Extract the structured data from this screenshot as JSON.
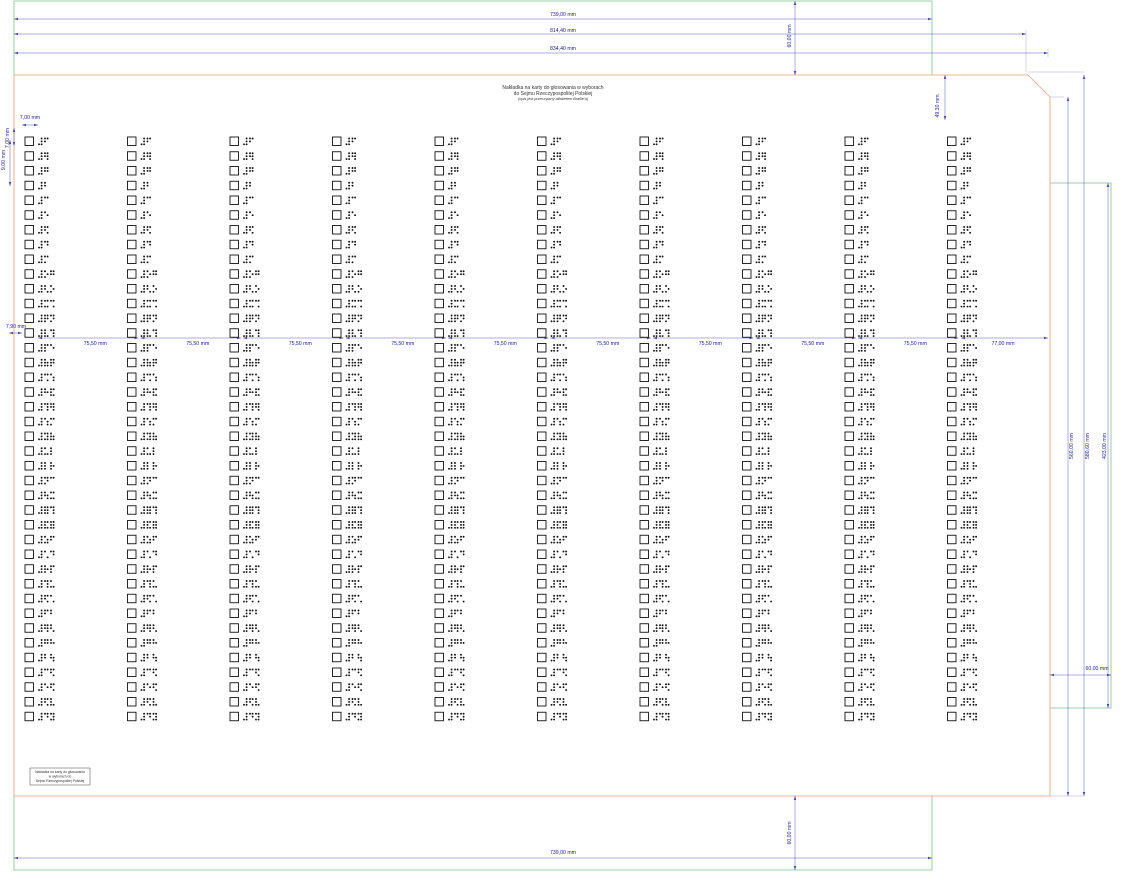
{
  "title": {
    "line1": "Nakładka na karty do głosowania w wyborach",
    "line2": "do Sejmu Rzeczypospolitej Polskiej",
    "line3": "(opis jest przeczytany alfabetem Braille'a)"
  },
  "stamp": {
    "line1": "Nakładka na karty do głosowania",
    "line2": "w wyborach do",
    "line3": "Sejmu Rzeczypospolitej Polskiej"
  },
  "dimensions": {
    "top_width_1": "739,00 mm",
    "top_width_2": "814,40 mm",
    "top_width_3": "834,40 mm",
    "top_height": "60,00 mm",
    "header_height": "49,30 mm",
    "margin_left": "7,00 mm",
    "row_pitch": "7,00 mm",
    "first_row_offset": "9,00 mm",
    "left_gap": "7,90 mm",
    "column_pitch": "75,50 mm",
    "last_column": "77,00 mm",
    "right_height_1": "560,00 mm",
    "right_height_2": "580,60 mm",
    "right_height_3": "423,00 mm",
    "right_tab": "60,00 mm",
    "bottom_height": "60,00 mm",
    "bottom_width": "739,00 mm"
  },
  "grid": {
    "columns": 10,
    "rows": 40
  },
  "colors": {
    "outline_orange": "#e8a07a",
    "outline_green": "#7fc08a",
    "dimension_blue": "#1a1a8c"
  }
}
